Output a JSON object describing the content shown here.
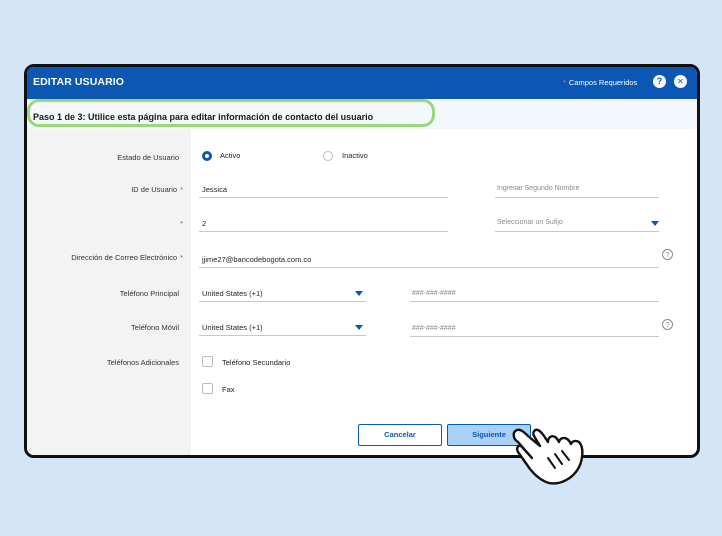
{
  "modal": {
    "title": "EDITAR USUARIO",
    "required_star": "*",
    "required_label": "Campos Requeridos",
    "help_glyph": "?",
    "close_glyph": "✕"
  },
  "step": {
    "text": "Paso 1 de 3:  Utilice esta página para editar información de contacto del usuario"
  },
  "form": {
    "status": {
      "label": "Estado de Usuario",
      "options": [
        "Activo",
        "Inactivo"
      ],
      "selected": "Activo"
    },
    "user_id": {
      "label": "ID de Usuario",
      "star": "*",
      "value": "Jessica",
      "second_name_placeholder": "Ingresar Segundo Nombre"
    },
    "row3": {
      "star": "*",
      "value": "2",
      "suffix_placeholder": "Seleccionar un Sufijo"
    },
    "email": {
      "label": "Dirección de Correo Electrónico",
      "star": "*",
      "value": "jjime27@bancodebogota.com.co"
    },
    "main_phone": {
      "label": "Teléfono Principal",
      "country": "United States (+1)",
      "placeholder": "###-###-####"
    },
    "mobile_phone": {
      "label": "Teléfono Móvil",
      "country": "United States (+1)",
      "placeholder": "###-###-####"
    },
    "additional": {
      "label": "Teléfonos Adicionales",
      "options": [
        "Teléfono Secundario",
        "Fax"
      ]
    },
    "help_glyph": "?"
  },
  "buttons": {
    "cancel": "Cancelar",
    "next": "Siguiente"
  },
  "colors": {
    "primary": "#0b57b3",
    "highlight": "#9fd67a",
    "required": "#d9383a",
    "background": "#d3e5f6"
  }
}
